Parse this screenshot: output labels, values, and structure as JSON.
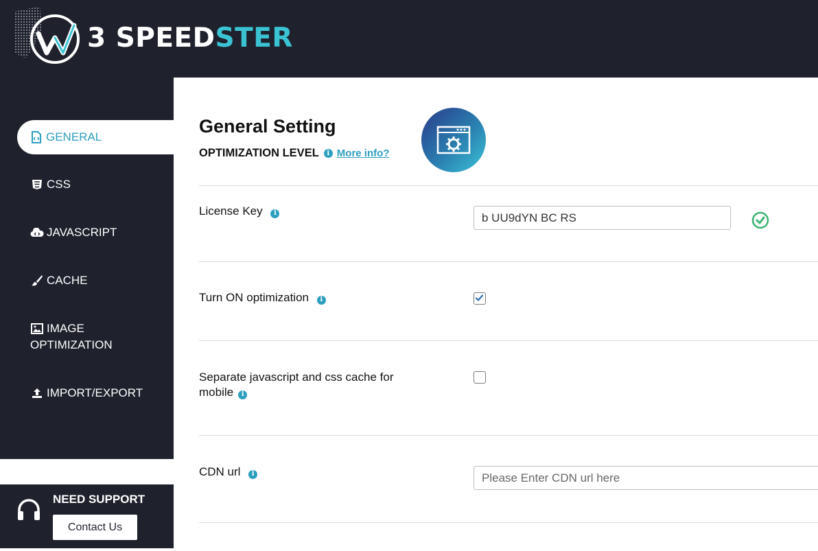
{
  "brand": {
    "name_prefix": "3 SPEED",
    "name_suffix": "STER",
    "accent_color": "#3ac3d3"
  },
  "sidebar": {
    "items": [
      {
        "label": "GENERAL",
        "icon": "file-code-icon",
        "active": true
      },
      {
        "label": "CSS",
        "icon": "css3-icon"
      },
      {
        "label": "JAVASCRIPT",
        "icon": "cloud-code-icon"
      },
      {
        "label": "CACHE",
        "icon": "brush-icon"
      },
      {
        "label": "IMAGE OPTIMIZATION",
        "label_line1": "IMAGE",
        "label_line2": "OPTIMIZATION",
        "icon": "image-icon"
      },
      {
        "label": "IMPORT/EXPORT",
        "icon": "upload-icon"
      }
    ]
  },
  "support": {
    "title": "NEED SUPPORT",
    "button_label": "Contact Us",
    "icon": "headset-icon"
  },
  "main": {
    "title": "General Setting",
    "optimization_level": "OPTIMIZATION LEVEL",
    "more_info": "More info?",
    "badge_icon": "settings-window-icon",
    "rows": {
      "license": {
        "label": "License Key",
        "value": "b UU9dYN BC RS",
        "status_icon": "check-circle-icon",
        "status_color": "#3cb371"
      },
      "optimization": {
        "label": "Turn ON optimization",
        "checked": true
      },
      "separate_cache": {
        "label_line1": "Separate javascript and css cache for",
        "label_line2": "mobile",
        "checked": false
      },
      "cdn": {
        "label": "CDN url",
        "placeholder": "Please Enter CDN url here",
        "value": ""
      }
    }
  },
  "colors": {
    "dark": "#1f222d",
    "accent": "#2c9fbf"
  }
}
